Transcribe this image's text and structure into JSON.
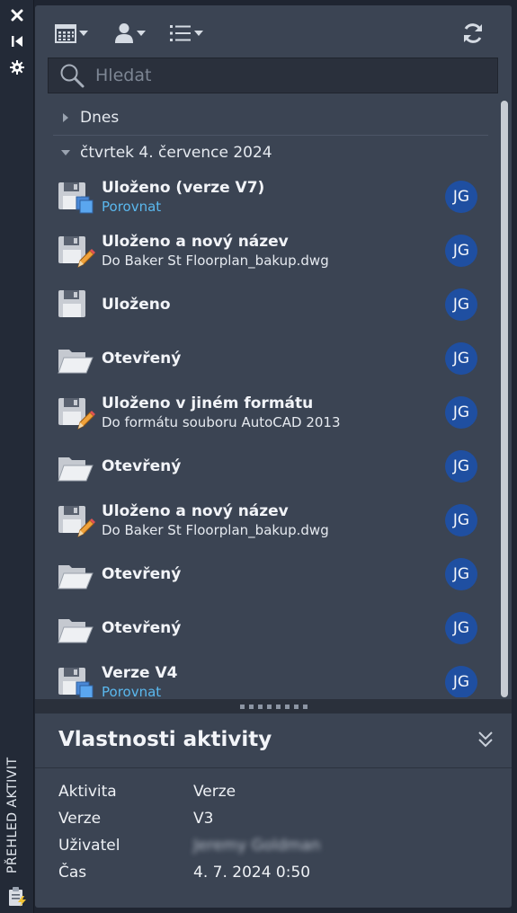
{
  "sidebar": {
    "title": "PŘEHLED AKTIVIT",
    "close_icon": "close-icon",
    "autohide_icon": "autohide-icon",
    "settings_icon": "gear-icon",
    "footer_icon": "clipboard-lightning-icon"
  },
  "toolbar": {
    "calendar_filter_icon": "calendar-icon",
    "user_filter_icon": "user-icon",
    "type_filter_icon": "list-icon",
    "refresh_icon": "refresh-icon"
  },
  "search": {
    "placeholder": "Hledat",
    "value": ""
  },
  "groups": [
    {
      "label": "Dnes",
      "expanded": false
    },
    {
      "label": "čtvrtek 4. července 2024",
      "expanded": true
    }
  ],
  "items": [
    {
      "icon": "save-version-icon",
      "title": "Uloženo (verze V7)",
      "sub": "Porovnat",
      "sub_is_link": true,
      "avatar": "JG"
    },
    {
      "icon": "save-as-icon",
      "title": "Uloženo a nový název",
      "sub": "Do Baker St Floorplan_bakup.dwg",
      "sub_is_link": false,
      "avatar": "JG"
    },
    {
      "icon": "save-icon",
      "title": "Uloženo",
      "sub": "",
      "sub_is_link": false,
      "avatar": "JG"
    },
    {
      "icon": "folder-open-icon",
      "title": "Otevřený",
      "sub": "",
      "sub_is_link": false,
      "avatar": "JG"
    },
    {
      "icon": "save-as-icon",
      "title": "Uloženo v jiném formátu",
      "sub": "Do formátu souboru AutoCAD 2013",
      "sub_is_link": false,
      "avatar": "JG"
    },
    {
      "icon": "folder-open-icon",
      "title": "Otevřený",
      "sub": "",
      "sub_is_link": false,
      "avatar": "JG"
    },
    {
      "icon": "save-as-icon",
      "title": "Uloženo a nový název",
      "sub": "Do Baker St Floorplan_bakup.dwg",
      "sub_is_link": false,
      "avatar": "JG"
    },
    {
      "icon": "folder-open-icon",
      "title": "Otevřený",
      "sub": "",
      "sub_is_link": false,
      "avatar": "JG"
    },
    {
      "icon": "folder-open-icon",
      "title": "Otevřený",
      "sub": "",
      "sub_is_link": false,
      "avatar": "JG"
    },
    {
      "icon": "save-version-icon",
      "title": "Verze V4",
      "sub": "Porovnat",
      "sub_is_link": true,
      "avatar": "JG"
    }
  ],
  "properties": {
    "title": "Vlastnosti aktivity",
    "rows": [
      {
        "key": "Aktivita",
        "value": "Verze"
      },
      {
        "key": "Verze",
        "value": "V3"
      },
      {
        "key": "Uživatel",
        "value": "Jeremy Goldman",
        "blurred": true
      },
      {
        "key": "Čas",
        "value": "4. 7. 2024 0:50"
      }
    ]
  },
  "colors": {
    "panel": "#3b4453",
    "avatar": "#1f4fa1",
    "link": "#5ab8ee",
    "background": "#1f2531"
  }
}
